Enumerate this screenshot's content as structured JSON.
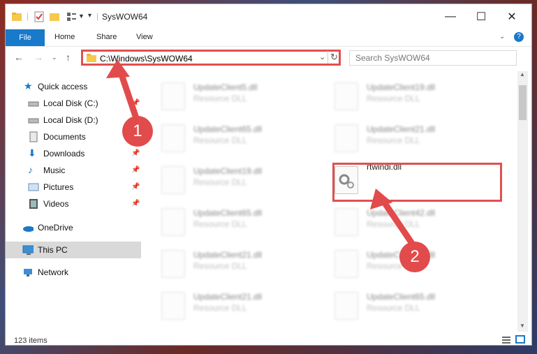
{
  "window": {
    "title": "SysWOW64"
  },
  "ribbon": {
    "file": "File",
    "home": "Home",
    "share": "Share",
    "view": "View"
  },
  "address": {
    "path": "C:\\Windows\\SysWOW64"
  },
  "search": {
    "placeholder": "Search SysWOW64"
  },
  "sidebar": {
    "items": [
      {
        "label": "Quick access"
      },
      {
        "label": "Local Disk (C:)"
      },
      {
        "label": "Local Disk (D:)"
      },
      {
        "label": "Documents"
      },
      {
        "label": "Downloads"
      },
      {
        "label": "Music"
      },
      {
        "label": "Pictures"
      },
      {
        "label": "Videos"
      },
      {
        "label": "OneDrive"
      },
      {
        "label": "This PC"
      },
      {
        "label": "Network"
      }
    ]
  },
  "files": {
    "left": [
      {
        "name": "UpdateClient5.dll",
        "type": "Resource DLL"
      },
      {
        "name": "UpdateClient65.dll",
        "type": "Resource DLL"
      },
      {
        "name": "UpdateClient19.dll",
        "type": "Resource DLL"
      },
      {
        "name": "UpdateClient65.dll",
        "type": "Resource DLL"
      },
      {
        "name": "UpdateClient21.dll",
        "type": "Resource DLL"
      },
      {
        "name": "UpdateClient21.dll",
        "type": "Resource DLL"
      }
    ],
    "right": [
      {
        "name": "UpdateClient19.dll",
        "type": "Resource DLL"
      },
      {
        "name": "UpdateClient21.dll",
        "type": "Resource DLL"
      },
      {
        "name": "rtwindi.dll",
        "type": ""
      },
      {
        "name": "UpdateClient42.dll",
        "type": "Resource DLL"
      },
      {
        "name": "UpdateClient43.dll",
        "type": "Resource DLL"
      },
      {
        "name": "UpdateClient65.dll",
        "type": "Resource DLL"
      }
    ]
  },
  "status": {
    "count": "123 items"
  },
  "annotations": {
    "one": "1",
    "two": "2"
  },
  "colors": {
    "accent": "#1979ca",
    "highlight": "#e05050"
  }
}
